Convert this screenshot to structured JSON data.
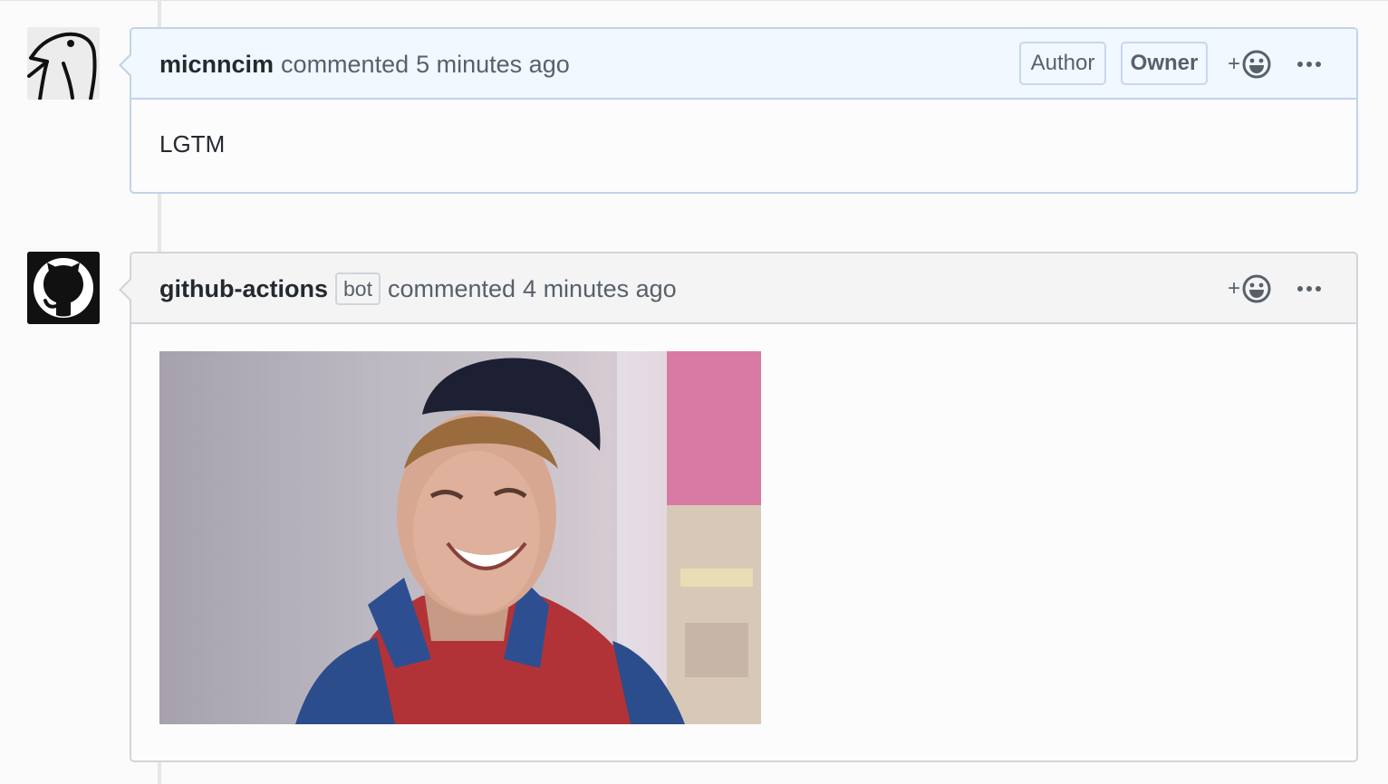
{
  "comments": [
    {
      "author": "micnncim",
      "action": "commented",
      "time": "5 minutes ago",
      "labels": [
        "Author",
        "Owner"
      ],
      "body": "LGTM",
      "reaction_plus": "+"
    },
    {
      "author": "github-actions",
      "badge": "bot",
      "action": "commented",
      "time": "4 minutes ago",
      "reaction_plus": "+",
      "image_alt": "animated GIF of smiling person in cap"
    }
  ],
  "icons": {
    "avatar_1": "bird-avatar-icon",
    "avatar_2": "github-octocat-icon",
    "reaction": "smiley-icon",
    "menu": "kebab-horizontal-icon"
  },
  "colors": {
    "author_header_bg": "#f1f8ff",
    "author_border": "#c0d3eb",
    "default_header_bg": "#f4f4f5",
    "default_border": "#d1d5da"
  }
}
